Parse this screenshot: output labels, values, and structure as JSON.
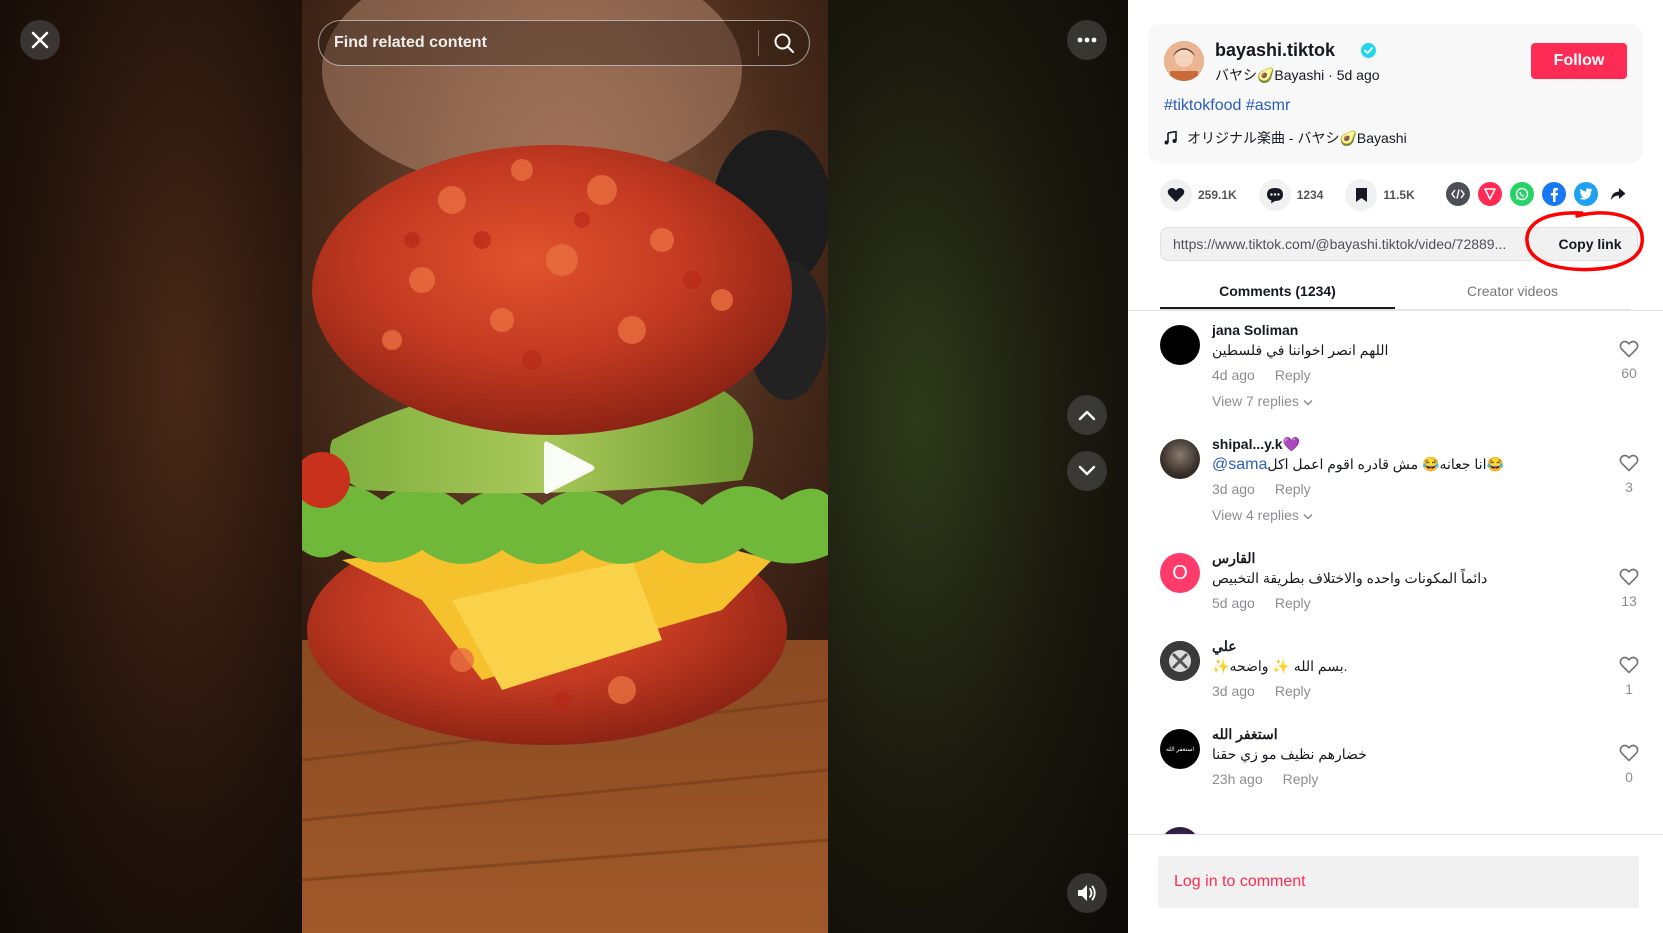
{
  "search": {
    "placeholder": "Find related content"
  },
  "author": {
    "username": "bayashi.tiktok",
    "nickname": "バヤシ🥑Bayashi",
    "posted": "5d ago",
    "separator": " · ",
    "follow_label": "Follow"
  },
  "post": {
    "hashtags": [
      "#tiktokfood",
      "#asmr"
    ],
    "music": "オリジナル楽曲 - バヤシ🥑Bayashi"
  },
  "stats": {
    "likes": "259.1K",
    "comments": "1234",
    "saves": "11.5K"
  },
  "share_icons": [
    "embed-icon",
    "send-icon",
    "whatsapp-icon",
    "facebook-icon",
    "twitter-icon",
    "share-arrow-icon"
  ],
  "link": {
    "url": "https://www.tiktok.com/@bayashi.tiktok/video/72889...",
    "copy_label": "Copy link"
  },
  "tabs": [
    {
      "label": "Comments (1234)"
    },
    {
      "label": "Creator videos"
    }
  ],
  "comments": [
    {
      "user": "jana Soliman",
      "text": "اللهم انصر اخواننا في فلسطين",
      "time": "4d ago",
      "reply": "Reply",
      "likes": "60",
      "view_replies": "View 7 replies"
    },
    {
      "user": "shipal...y.k💜",
      "text": "انا جعانه😂 مش قادره اقوم اعمل اكل😂",
      "mention": "@sama",
      "time": "3d ago",
      "reply": "Reply",
      "likes": "3",
      "view_replies": "View 4 replies"
    },
    {
      "user": "القارس",
      "text": "دائماً المكونات واحده والاختلاف بطريقة التخبيص",
      "time": "5d ago",
      "reply": "Reply",
      "likes": "13",
      "avatar_letter": "O"
    },
    {
      "user": "علي",
      "text": "✨بسم الله ✨ واضحه.",
      "time": "3d ago",
      "reply": "Reply",
      "likes": "1"
    },
    {
      "user": "استغفر الله",
      "text": "خضارهم نظيف مو زي حقنا",
      "time": "23h ago",
      "reply": "Reply",
      "likes": "0",
      "avatar_text": "استغفر الله"
    }
  ],
  "login": {
    "label": "Log in to comment"
  },
  "colors": {
    "accent": "#fe2c55",
    "link": "#2b5db9",
    "annotation": "#ff0000"
  }
}
